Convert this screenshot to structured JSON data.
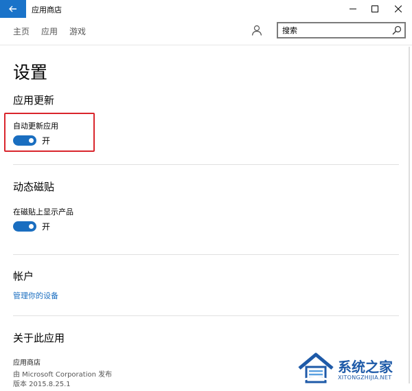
{
  "window": {
    "title": "应用商店"
  },
  "nav": {
    "items": [
      {
        "label": "主页"
      },
      {
        "label": "应用"
      },
      {
        "label": "游戏"
      }
    ],
    "search": {
      "placeholder": "搜索"
    }
  },
  "page": {
    "title": "设置",
    "sections": {
      "updates": {
        "title": "应用更新",
        "setting_label": "自动更新应用",
        "toggle_state": "开",
        "toggle_on": true
      },
      "tiles": {
        "title": "动态磁贴",
        "setting_label": "在磁贴上显示产品",
        "toggle_state": "开",
        "toggle_on": true
      },
      "account": {
        "title": "帐户",
        "link": "管理你的设备"
      },
      "about": {
        "title": "关于此应用",
        "app_name": "应用商店",
        "publisher": "由 Microsoft Corporation 发布",
        "version": "版本 2015.8.25.1"
      }
    }
  },
  "watermark": {
    "text": "系统之家",
    "url": "XITONGZHIJIA.NET"
  },
  "colors": {
    "accent": "#1a6ec0",
    "back_button": "#1a73c9",
    "highlight": "#d9242b"
  }
}
